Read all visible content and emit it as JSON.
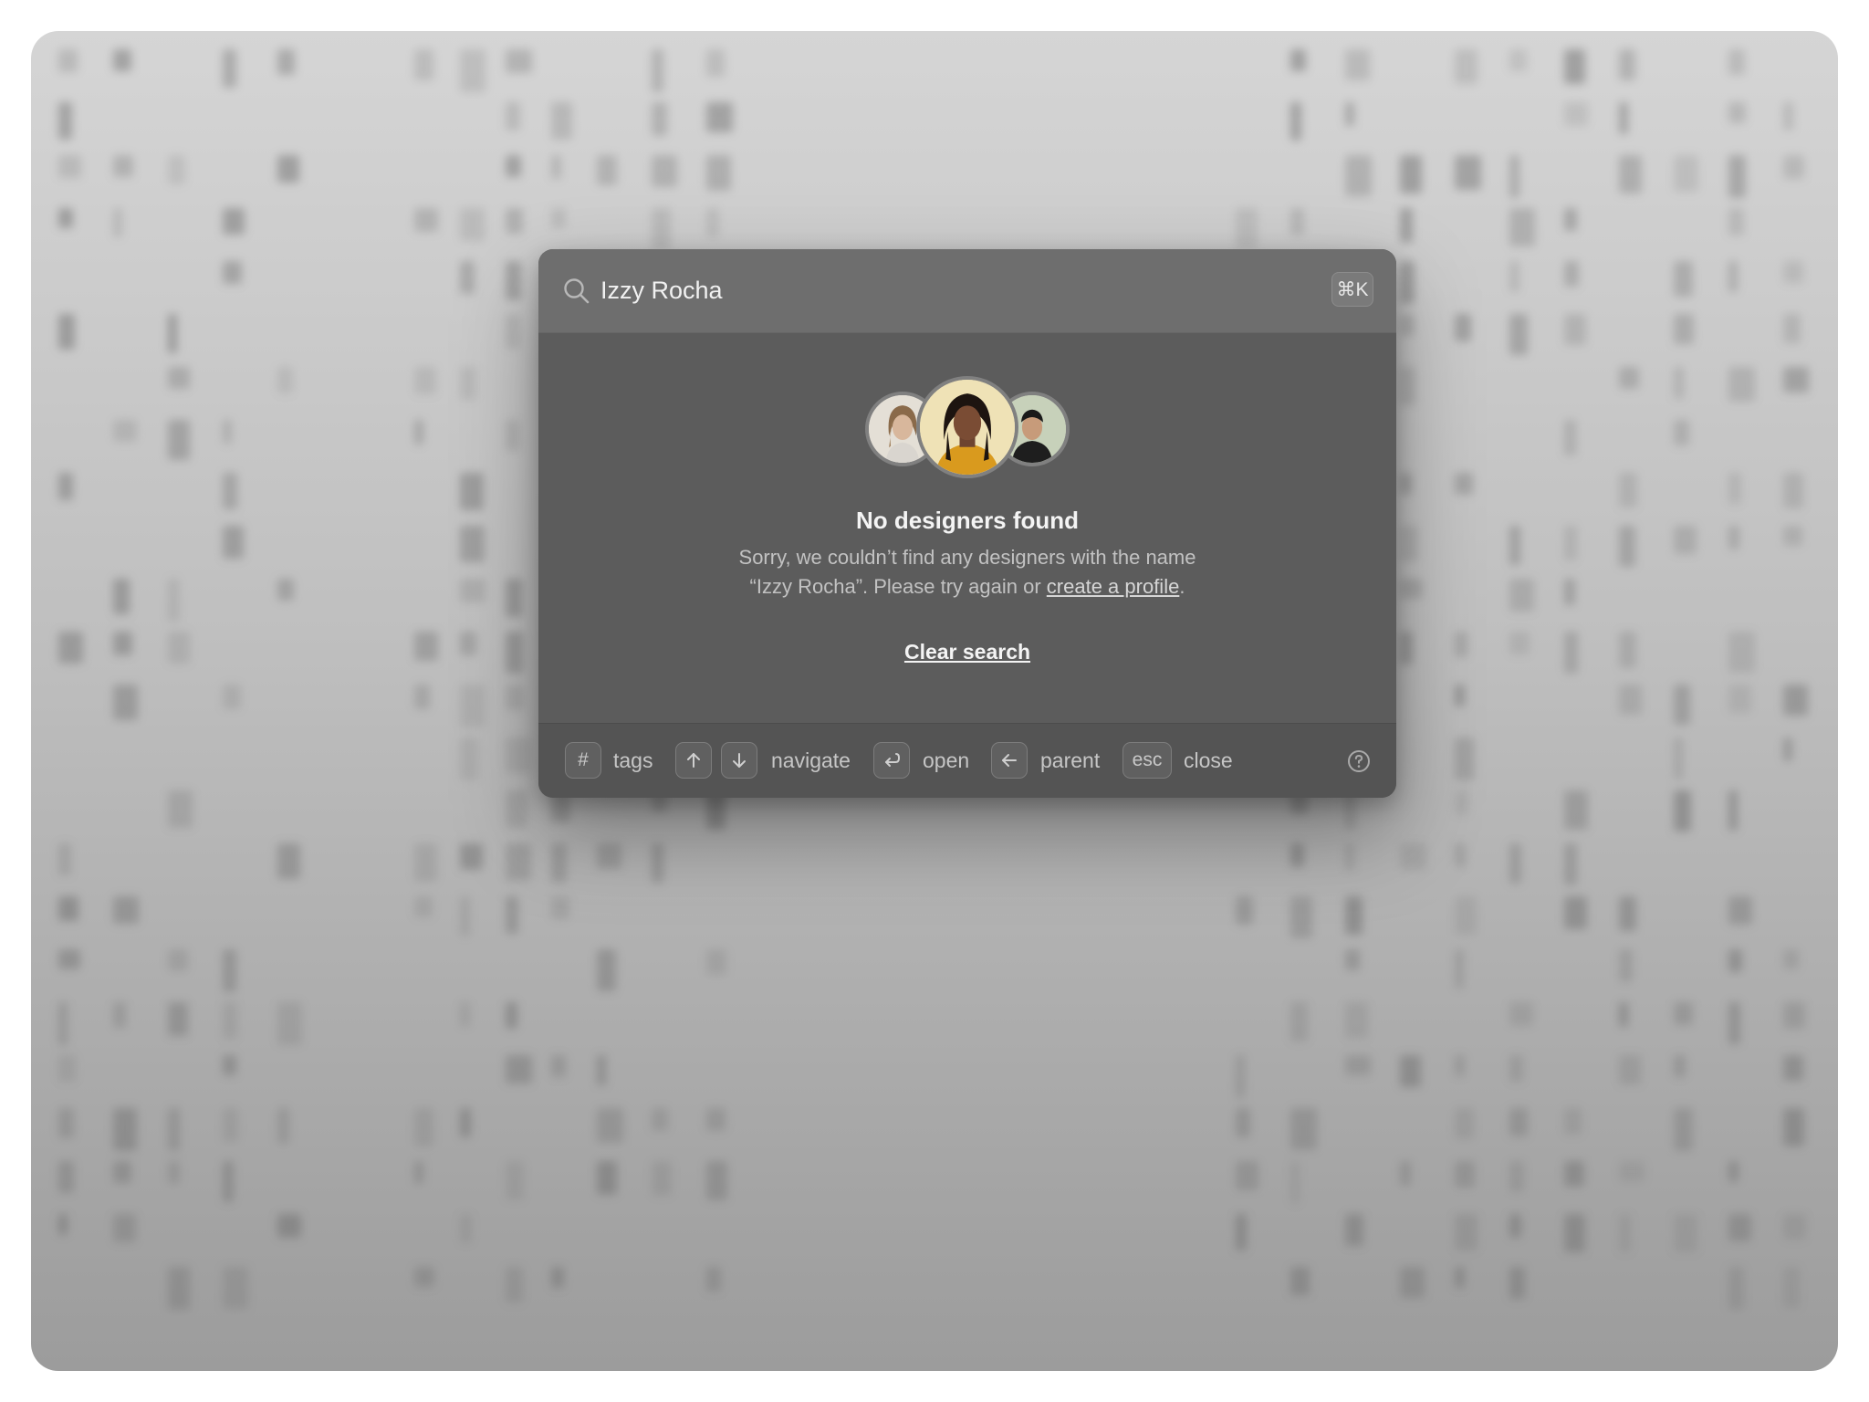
{
  "search": {
    "value": "Izzy Rocha",
    "placeholder": "",
    "shortcut": "⌘K",
    "icon": "search-icon"
  },
  "empty_state": {
    "title": "No designers found",
    "desc_line1": "Sorry, we couldn’t find any designers with the name",
    "desc_line2_prefix": "“Izzy Rocha”. Please try again or ",
    "create_profile_link": "create a profile",
    "desc_line2_suffix": ".",
    "clear_search": "Clear search"
  },
  "footer": {
    "tags_key": "#",
    "tags_label": "tags",
    "navigate_label": "navigate",
    "open_label": "open",
    "parent_label": "parent",
    "esc_key": "esc",
    "close_label": "close",
    "help_icon": "help-circle-icon"
  },
  "colors": {
    "panel": "#5c5c5c",
    "search_row": "#6e6e6e",
    "footer": "#545454",
    "text_primary": "#f4f4f4",
    "text_secondary": "#c2c2c2"
  }
}
